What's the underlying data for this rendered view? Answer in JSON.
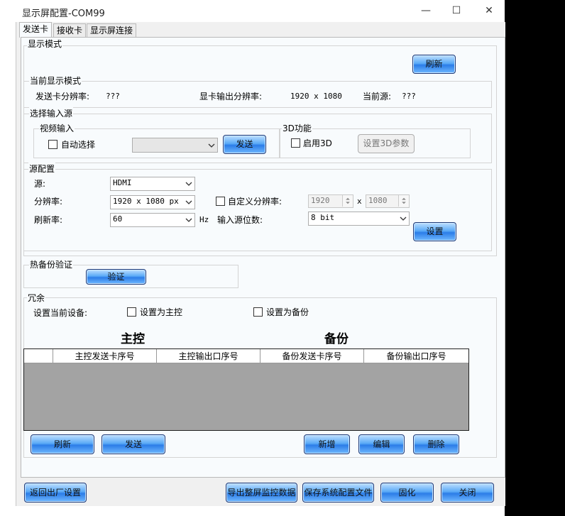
{
  "window": {
    "title": "显示屏配置-COM99",
    "minimize": "—",
    "maximize": "☐",
    "close": "✕"
  },
  "tabs": [
    "发送卡",
    "接收卡",
    "显示屏连接"
  ],
  "display_mode": {
    "group_label": "显示模式",
    "refresh_btn": "刷新",
    "current_mode_label": "当前显示模式",
    "sender_res_label": "发送卡分辨率:",
    "sender_res_value": "???",
    "gpu_res_label": "显卡输出分辨率:",
    "gpu_res_value": "1920 x 1080",
    "current_source_label": "当前源:",
    "current_source_value": "???"
  },
  "input_source": {
    "group_label": "选择输入源",
    "video_label": "视频输入",
    "auto_select": "自动选择",
    "send_btn": "发送",
    "threed_label": "3D功能",
    "enable_3d": "启用3D",
    "set_3d_btn": "设置3D参数"
  },
  "source_config": {
    "group_label": "源配置",
    "source_label": "源:",
    "source_value": "HDMI",
    "resolution_label": "分辨率:",
    "resolution_value": "1920 x 1080 px",
    "custom_res_label": "自定义分辨率:",
    "custom_width": "1920",
    "custom_x": "x",
    "custom_height": "1080",
    "refresh_label": "刷新率:",
    "refresh_value": "60",
    "hz": "Hz",
    "bitdepth_label": "输入源位数:",
    "bitdepth_value": "8 bit",
    "set_btn": "设置"
  },
  "hot_backup": {
    "group_label": "热备份验证",
    "verify_btn": "验证"
  },
  "redundancy": {
    "group_label": "冗余",
    "current_device_label": "设置当前设备:",
    "set_master": "设置为主控",
    "set_backup": "设置为备份",
    "master_title": "主控",
    "backup_title": "备份",
    "columns": [
      "主控发送卡序号",
      "主控输出口序号",
      "备份发送卡序号",
      "备份输出口序号"
    ],
    "refresh_btn": "刷新",
    "send_btn": "发送",
    "add_btn": "新增",
    "edit_btn": "编辑",
    "delete_btn": "删除"
  },
  "footer": {
    "factory_btn": "返回出厂设置",
    "export_btn": "导出整屏监控数据",
    "save_btn": "保存系统配置文件",
    "solidify_btn": "固化",
    "close_btn": "关闭"
  }
}
